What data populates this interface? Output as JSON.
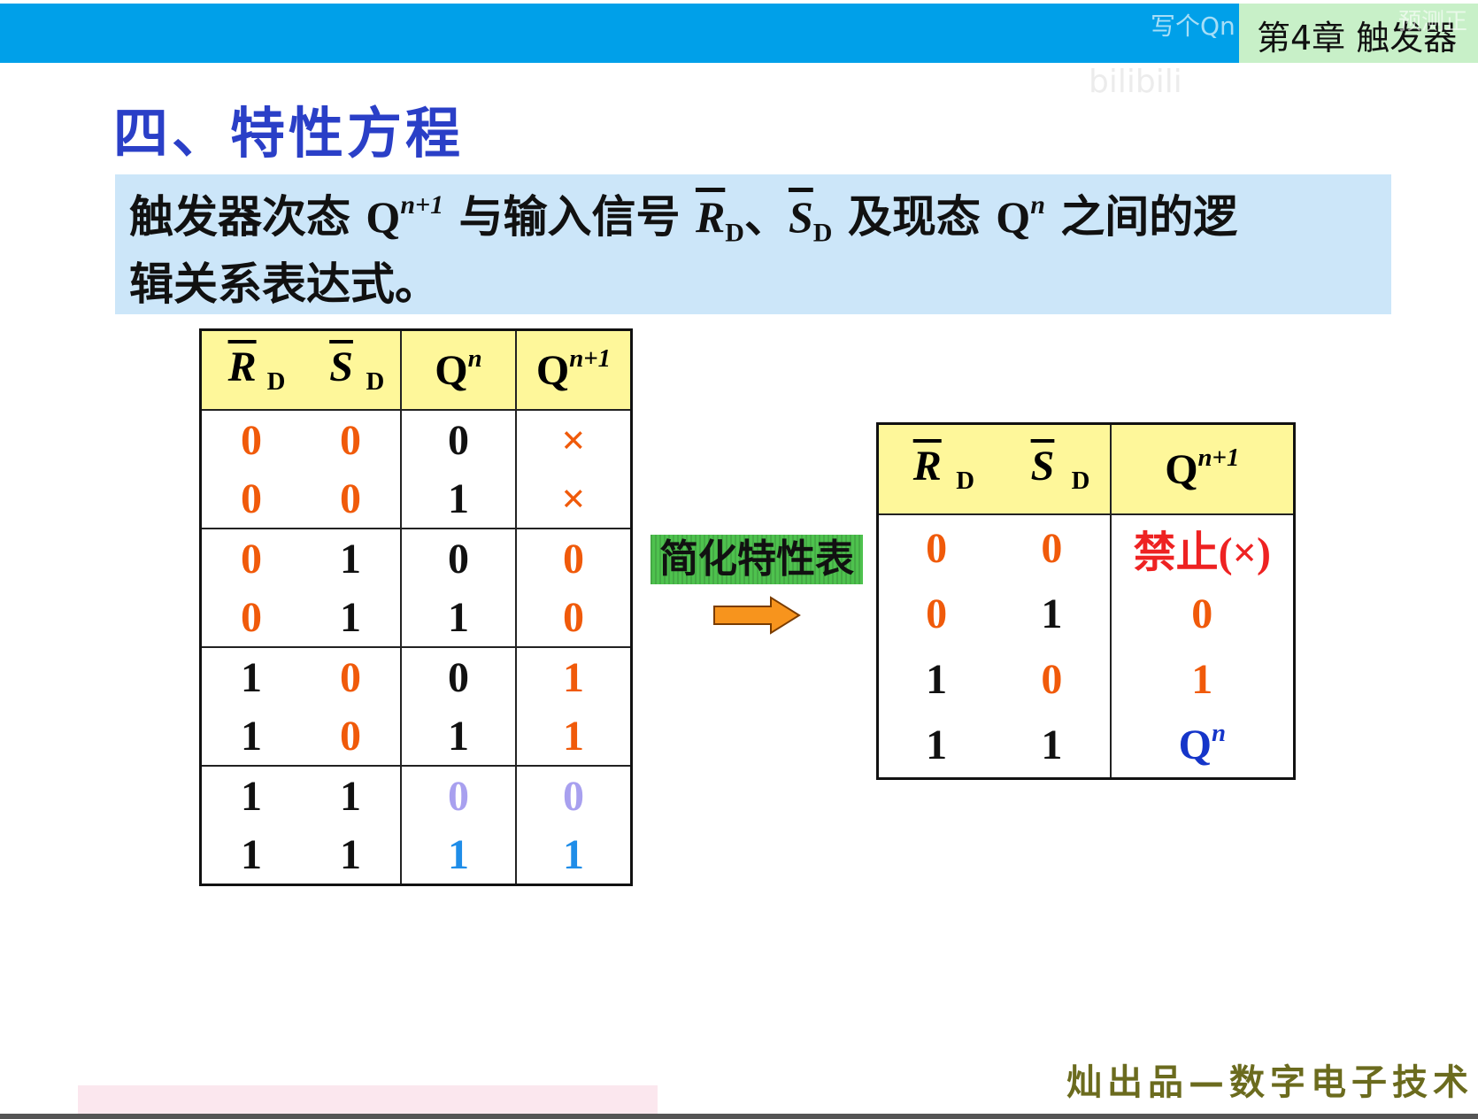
{
  "header": {
    "chapter": "第4章 触发器",
    "watermark_left": "写个Qn",
    "watermark_right": "预测正",
    "watermark_user": "bilibili"
  },
  "heading": "四、特性方程",
  "definition": {
    "line1_a": "触发器次态 ",
    "q": "Q",
    "sup_n1": "n+1",
    "line1_b": " 与输入信号 ",
    "r": "R",
    "sub_d": "D",
    "sep": "、",
    "s": "S",
    "line1_c": " 及现态 ",
    "sup_n": "n",
    "line1_d": " 之间的逻",
    "line2": "辑关系表达式。"
  },
  "full_table": {
    "headers": {
      "r": "R",
      "s": "S",
      "d": "D",
      "q": "Q",
      "n": "n",
      "n1": "n+1"
    },
    "rows": [
      {
        "rd": "0",
        "sd": "0",
        "qn": "0",
        "qn1": "×"
      },
      {
        "rd": "0",
        "sd": "0",
        "qn": "1",
        "qn1": "×"
      },
      {
        "rd": "0",
        "sd": "1",
        "qn": "0",
        "qn1": "0"
      },
      {
        "rd": "0",
        "sd": "1",
        "qn": "1",
        "qn1": "0"
      },
      {
        "rd": "1",
        "sd": "0",
        "qn": "0",
        "qn1": "1"
      },
      {
        "rd": "1",
        "sd": "0",
        "qn": "1",
        "qn1": "1"
      },
      {
        "rd": "1",
        "sd": "1",
        "qn": "0",
        "qn1": "0"
      },
      {
        "rd": "1",
        "sd": "1",
        "qn": "1",
        "qn1": "1"
      }
    ]
  },
  "arrow_label": "简化特性表",
  "simplified_table": {
    "rows": [
      {
        "rd": "0",
        "sd": "0",
        "out": "禁止(×)"
      },
      {
        "rd": "0",
        "sd": "1",
        "out": "0"
      },
      {
        "rd": "1",
        "sd": "0",
        "out": "1"
      },
      {
        "rd": "1",
        "sd": "1",
        "out_q": "Q",
        "out_n": "n"
      }
    ]
  },
  "footer": "灿出品—数字电子技术",
  "colors": {
    "topbar": "#00a0e9",
    "heading": "#2a3fc7",
    "defbox": "#cce6f9",
    "header_row": "#fef79a",
    "red": "#f05a0a",
    "lavender": "#a8a0ef",
    "blue": "#1f8de8",
    "arrow": "#f7941d"
  }
}
